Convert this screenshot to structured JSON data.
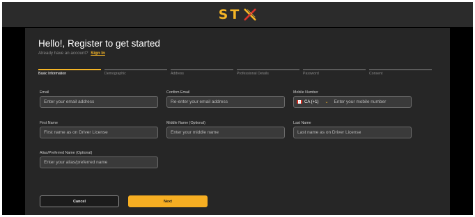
{
  "header": {
    "logo_text": "ST",
    "logo_icon": "x-logo-icon"
  },
  "form": {
    "title": "Hello!, Register to get started",
    "subtitle": "Already have an account?",
    "signin_label": "Sign In"
  },
  "steps": [
    {
      "label": "Basic Information",
      "active": true
    },
    {
      "label": "Demographic",
      "active": false
    },
    {
      "label": "Address",
      "active": false
    },
    {
      "label": "Professional Details",
      "active": false
    },
    {
      "label": "Password",
      "active": false
    },
    {
      "label": "Consent",
      "active": false
    }
  ],
  "fields": {
    "email": {
      "label": "Email",
      "placeholder": "Enter your email address",
      "value": ""
    },
    "confirm_email": {
      "label": "Confirm Email",
      "placeholder": "Re-enter your email address",
      "value": ""
    },
    "mobile": {
      "label": "Mobile Number",
      "country_code": "CA (+1)",
      "placeholder": "Enter your mobile number",
      "value": ""
    },
    "first_name": {
      "label": "First Name",
      "placeholder": "First name as on Driver License",
      "value": ""
    },
    "middle_name": {
      "label": "Middle Name (Optional)",
      "placeholder": "Enter your middle name",
      "value": ""
    },
    "last_name": {
      "label": "Last Name",
      "placeholder": "Last name as on Driver License",
      "value": ""
    },
    "alias": {
      "label": "Alias/Preferred Name (Optional)",
      "placeholder": "Enter your alias/preferred name",
      "value": ""
    }
  },
  "buttons": {
    "cancel_label": "Cancel",
    "next_label": "Next"
  },
  "colors": {
    "accent": "#f5b526",
    "button_next": "#f6ae22",
    "panel": "#262626",
    "page_background": "#000000",
    "header_background": "#2b2b2b",
    "input_background": "#3a3a3a"
  }
}
